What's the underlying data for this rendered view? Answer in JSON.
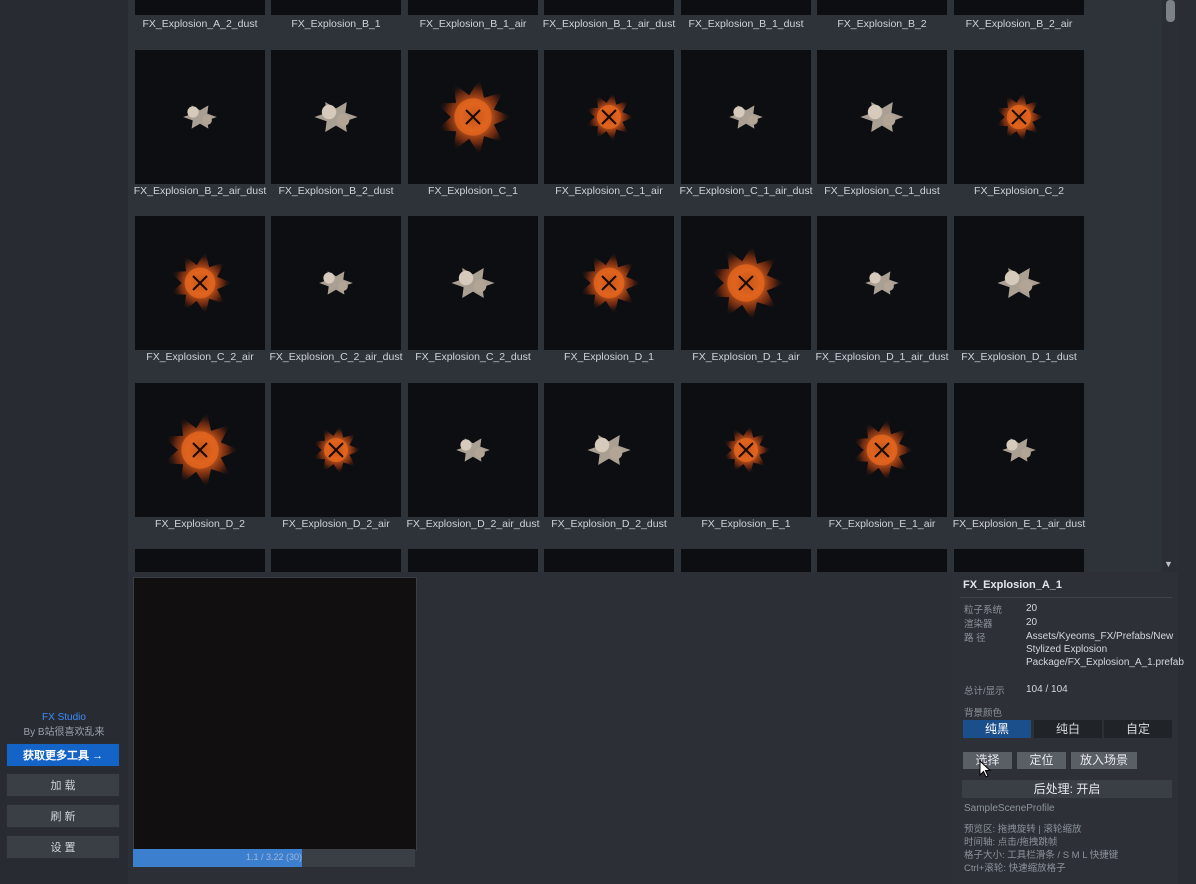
{
  "grid": {
    "top_labels": [
      "FX_Explosion_A_2_dust",
      "FX_Explosion_B_1",
      "FX_Explosion_B_1_air",
      "FX_Explosion_B_1_air_dust",
      "FX_Explosion_B_1_dust",
      "FX_Explosion_B_2",
      "FX_Explosion_B_2_air"
    ],
    "rows": [
      [
        {
          "label": "FX_Explosion_B_2_air_dust",
          "kind": "dust"
        },
        {
          "label": "FX_Explosion_B_2_dust",
          "kind": "dust"
        },
        {
          "label": "FX_Explosion_C_1",
          "kind": "fire"
        },
        {
          "label": "FX_Explosion_C_1_air",
          "kind": "fire"
        },
        {
          "label": "FX_Explosion_C_1_air_dust",
          "kind": "dust"
        },
        {
          "label": "FX_Explosion_C_1_dust",
          "kind": "dust"
        },
        {
          "label": "FX_Explosion_C_2",
          "kind": "fire"
        }
      ],
      [
        {
          "label": "FX_Explosion_C_2_air",
          "kind": "fire"
        },
        {
          "label": "FX_Explosion_C_2_air_dust",
          "kind": "dust"
        },
        {
          "label": "FX_Explosion_C_2_dust",
          "kind": "dust"
        },
        {
          "label": "FX_Explosion_D_1",
          "kind": "fire"
        },
        {
          "label": "FX_Explosion_D_1_air",
          "kind": "fire"
        },
        {
          "label": "FX_Explosion_D_1_air_dust",
          "kind": "dust"
        },
        {
          "label": "FX_Explosion_D_1_dust",
          "kind": "dust"
        }
      ],
      [
        {
          "label": "FX_Explosion_D_2",
          "kind": "fire"
        },
        {
          "label": "FX_Explosion_D_2_air",
          "kind": "fire"
        },
        {
          "label": "FX_Explosion_D_2_air_dust",
          "kind": "dust"
        },
        {
          "label": "FX_Explosion_D_2_dust",
          "kind": "dust"
        },
        {
          "label": "FX_Explosion_E_1",
          "kind": "fire"
        },
        {
          "label": "FX_Explosion_E_1_air",
          "kind": "fire"
        },
        {
          "label": "FX_Explosion_E_1_air_dust",
          "kind": "dust"
        }
      ]
    ]
  },
  "sidebar": {
    "brand_title": "FX Studio",
    "brand_sub": "By B站很喜欢乱来",
    "get_more_tools": "获取更多工具 →",
    "load": "加 载",
    "refresh": "刷 新",
    "settings": "设 置"
  },
  "timeline": {
    "text": "1.1 / 3.22 (30)",
    "progress": 0.6
  },
  "info": {
    "title": "FX_Explosion_A_1",
    "particle_key": "粒子系统",
    "particle_val": "20",
    "renderer_key": "渲染器",
    "renderer_val": "20",
    "path_key": "路 径",
    "path_val": "Assets/Kyeoms_FX/Prefabs/New Stylized Explosion Package/FX_Explosion_A_1.prefab",
    "total_key": "总计/显示",
    "total_val": "104 / 104",
    "bg_label": "背景颜色",
    "bg_black": "纯黑",
    "bg_white": "纯白",
    "bg_custom": "自定",
    "btn_select": "选择",
    "btn_locate": "定位",
    "btn_place": "放入场景",
    "post_process": "后处理: 开启",
    "profile": "SampleSceneProfile",
    "tip1": "预览区: 拖拽旋转 | 滚轮缩放",
    "tip2": "时间轴: 点击/拖拽跳帧",
    "tip3": "格子大小: 工具栏滑条 / S M L 快捷键",
    "tip4": "Ctrl+滚轮: 快速缩放格子"
  },
  "colors": {
    "accent": "#1463c6",
    "fire": "#e0641e",
    "dust": "#c7b9aa"
  }
}
